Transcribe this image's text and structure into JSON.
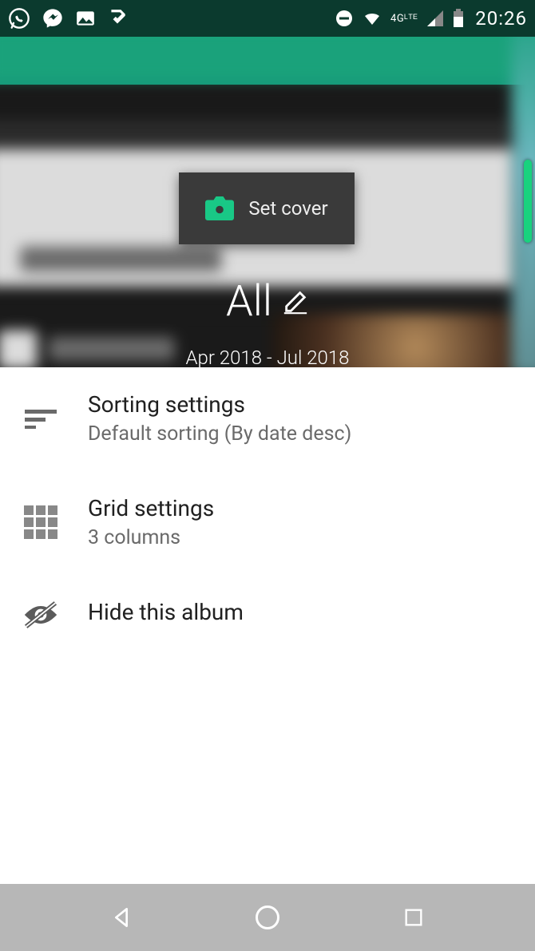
{
  "status": {
    "time": "20:26",
    "network": "4Gᴸᵀᴱ"
  },
  "header": {
    "set_cover_label": "Set cover",
    "album_name": "All",
    "date_range": "Apr 2018 - Jul 2018"
  },
  "settings": {
    "sorting": {
      "title": "Sorting settings",
      "subtitle": "Default sorting (By date desc)"
    },
    "grid": {
      "title": "Grid settings",
      "subtitle": "3 columns"
    },
    "hide": {
      "title": "Hide this album"
    }
  }
}
